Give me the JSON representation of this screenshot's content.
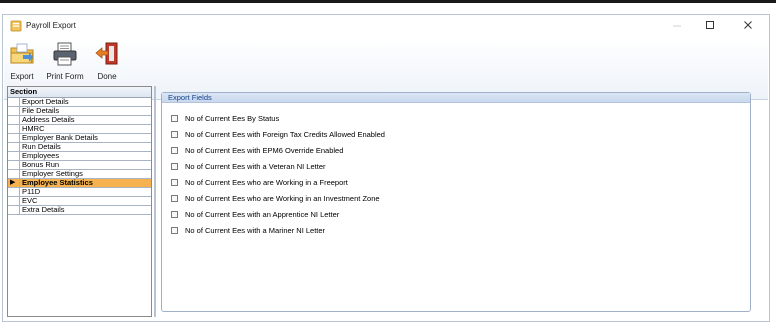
{
  "window": {
    "title": "Payroll Export"
  },
  "toolbar": {
    "buttons": [
      {
        "label": "Export",
        "icon": "export-folder-icon"
      },
      {
        "label": "Print Form",
        "icon": "print-form-icon"
      },
      {
        "label": "Done",
        "icon": "done-exit-icon"
      }
    ]
  },
  "section": {
    "header": "Section",
    "items": [
      "Export Details",
      "File Details",
      "Address Details",
      "HMRC",
      "Employer Bank Details",
      "Run Details",
      "Employees",
      "Bonus Run",
      "Employer Settings",
      "Employee Statistics",
      "P11D",
      "EVC",
      "Extra Details"
    ],
    "selected_index": 9
  },
  "export_fields": {
    "header": "Export Fields",
    "fields": [
      {
        "label": "No of Current Ees By Status",
        "checked": false
      },
      {
        "label": "No of Current Ees with Foreign Tax Credits Allowed Enabled",
        "checked": false
      },
      {
        "label": "No of Current Ees with EPM6 Override Enabled",
        "checked": false
      },
      {
        "label": "No of Current Ees with a Veteran NI Letter",
        "checked": false
      },
      {
        "label": "No of Current Ees who are Working in a Freeport",
        "checked": false
      },
      {
        "label": "No of Current Ees who are Working in an Investment Zone",
        "checked": false
      },
      {
        "label": "No of Current Ees with an Apprentice NI Letter",
        "checked": false
      },
      {
        "label": "No of Current Ees with a Mariner NI Letter",
        "checked": false
      }
    ]
  },
  "colors": {
    "selected_row": "#f6b24f",
    "header_text": "#15428b"
  }
}
